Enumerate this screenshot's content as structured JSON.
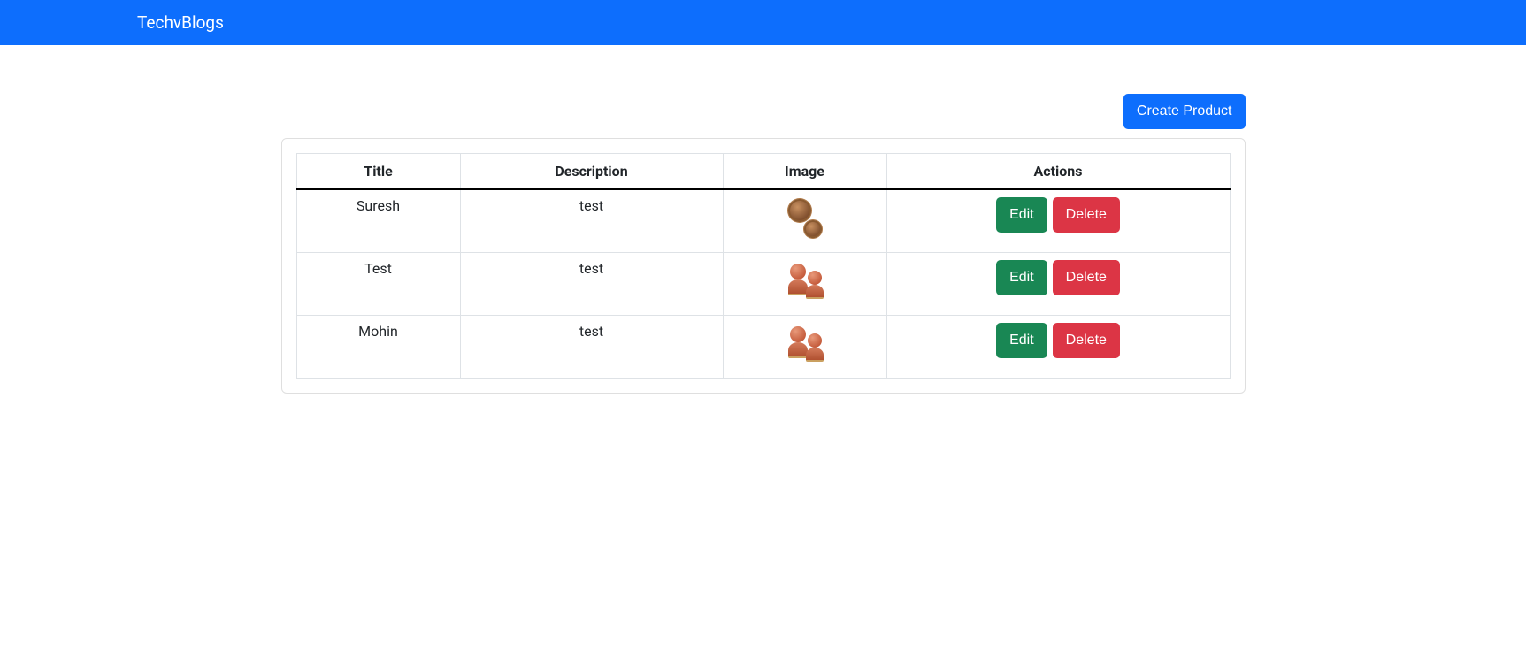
{
  "navbar": {
    "brand": "TechvBlogs"
  },
  "buttons": {
    "create": "Create Product",
    "edit": "Edit",
    "delete": "Delete"
  },
  "table": {
    "headers": {
      "title": "Title",
      "description": "Description",
      "image": "Image",
      "actions": "Actions"
    },
    "rows": [
      {
        "title": "Suresh",
        "description": "test",
        "image_variant": "a"
      },
      {
        "title": "Test",
        "description": "test",
        "image_variant": "b"
      },
      {
        "title": "Mohin",
        "description": "test",
        "image_variant": "b"
      }
    ]
  }
}
